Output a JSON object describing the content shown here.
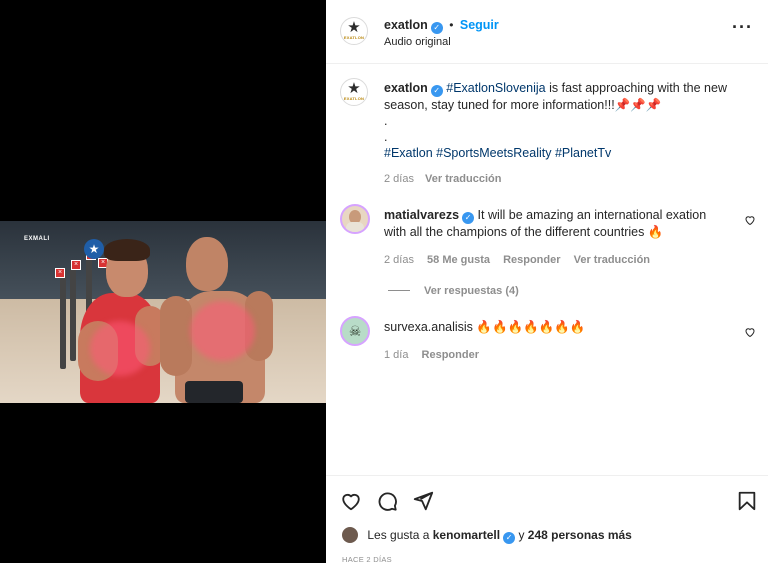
{
  "video": {
    "watermark": "EXMALI"
  },
  "header": {
    "username": "exatlon",
    "verified_icon": "verified-badge-icon",
    "separator": "•",
    "follow_label": "Seguir",
    "subtitle": "Audio original",
    "more_icon": "more-options-icon",
    "logo_text": "EXATLON"
  },
  "caption": {
    "username": "exatlon",
    "hashtag_lead": "#ExatlonSlovenija",
    "text_rest": " is fast approaching with the new season, stay tuned for more information!!!",
    "pin_icons": "📌📌📌",
    "dot1": ".",
    "dot2": ".",
    "tag1": "#Exatlon",
    "tag2": "#SportsMeetsReality",
    "tag3": "#PlanetTv",
    "time": "2 días",
    "translate": "Ver traducción"
  },
  "comments": [
    {
      "username": "matialvarezs",
      "text": "It will be amazing an international exation with all the champions of the different countries 🔥",
      "time": "2 días",
      "likes": "58 Me gusta",
      "reply": "Responder",
      "translate": "Ver traducción",
      "view_replies": "Ver respuestas (4)"
    },
    {
      "username": "survexa.analisis",
      "text": "🔥🔥🔥🔥🔥🔥🔥",
      "time": "1 día",
      "reply": "Responder"
    }
  ],
  "actions": {
    "like_icon": "heart-icon",
    "comment_icon": "comment-icon",
    "share_icon": "share-icon",
    "save_icon": "bookmark-icon",
    "likes_prefix": "Les gusta a",
    "likes_user": "kenomartell",
    "likes_suffix": "y",
    "likes_count": "248 personas más",
    "timestamp": "HACE 2 DÍAS"
  },
  "colors": {
    "link_blue": "#0095f6",
    "hashtag": "#00376b",
    "muted": "#8e8e8e",
    "verified": "#3897f0"
  }
}
